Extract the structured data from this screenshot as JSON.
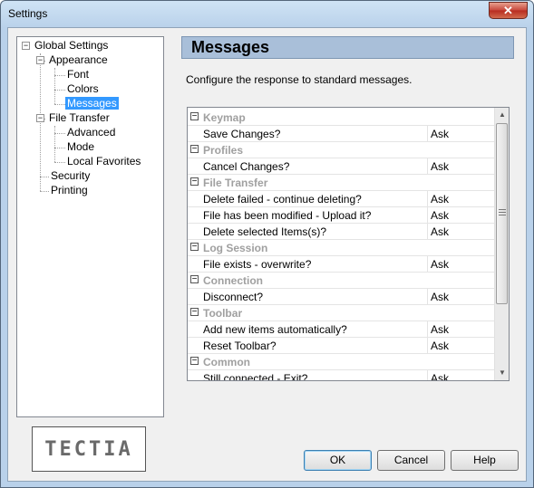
{
  "window": {
    "title": "Settings",
    "close_glyph": "✕"
  },
  "tree": {
    "expander_glyph": "−",
    "items": [
      {
        "label": "Global Settings"
      },
      {
        "label": "Appearance"
      },
      {
        "label": "Font"
      },
      {
        "label": "Colors"
      },
      {
        "label": "Messages"
      },
      {
        "label": "File Transfer"
      },
      {
        "label": "Advanced"
      },
      {
        "label": "Mode"
      },
      {
        "label": "Local Favorites"
      },
      {
        "label": "Security"
      },
      {
        "label": "Printing"
      }
    ]
  },
  "logo": {
    "text": "TECTIA"
  },
  "page": {
    "title": "Messages",
    "description": "Configure the response to standard messages."
  },
  "messages": {
    "group_glyph": "−",
    "groups": [
      {
        "name": "Keymap",
        "rows": [
          {
            "message": "Save Changes?",
            "response": "Ask"
          }
        ]
      },
      {
        "name": "Profiles",
        "rows": [
          {
            "message": "Cancel Changes?",
            "response": "Ask"
          }
        ]
      },
      {
        "name": "File Transfer",
        "rows": [
          {
            "message": "Delete failed - continue deleting?",
            "response": "Ask"
          },
          {
            "message": "File has been modified - Upload it?",
            "response": "Ask"
          },
          {
            "message": "Delete selected Items(s)?",
            "response": "Ask"
          }
        ]
      },
      {
        "name": "Log Session",
        "rows": [
          {
            "message": "File exists - overwrite?",
            "response": "Ask"
          }
        ]
      },
      {
        "name": "Connection",
        "rows": [
          {
            "message": "Disconnect?",
            "response": "Ask"
          }
        ]
      },
      {
        "name": "Toolbar",
        "rows": [
          {
            "message": "Add new items automatically?",
            "response": "Ask"
          },
          {
            "message": "Reset Toolbar?",
            "response": "Ask"
          }
        ]
      },
      {
        "name": "Common",
        "rows": [
          {
            "message": "Still connected - Exit?",
            "response": "Ask"
          }
        ]
      }
    ]
  },
  "scrollbar": {
    "up_glyph": "▲",
    "down_glyph": "▼"
  },
  "buttons": {
    "ok": "OK",
    "cancel": "Cancel",
    "help": "Help"
  }
}
